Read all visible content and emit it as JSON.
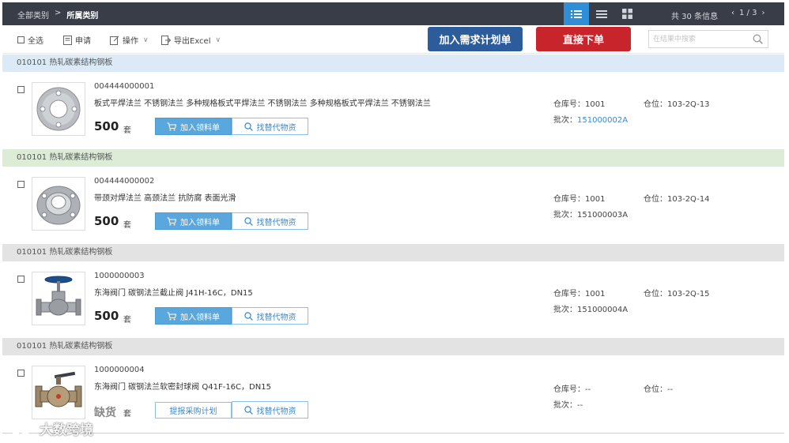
{
  "breadcrumb": {
    "root": "全部类别",
    "separator": ">",
    "current": "所属类别"
  },
  "view_modes": {
    "active": "detail-list",
    "icons": [
      "detail-list-icon",
      "list-icon",
      "grid-icon"
    ]
  },
  "summary": {
    "total": "共 30 条信息",
    "page": "1 / 3",
    "prev": "‹",
    "next": "›"
  },
  "toolbar": {
    "select_all": "全选",
    "apply": "申请",
    "operate": "操作",
    "export": "导出Excel",
    "add_plan": "加入需求计划单",
    "order_now": "直接下单",
    "search_placeholder": "在结果中搜索"
  },
  "labels": {
    "warehouse": "仓库号：",
    "location": "仓位：",
    "batch": "批次：",
    "add_to_list": "加入领料单",
    "find_substitute": "找替代物资",
    "purchase_plan": "提报采购计划"
  },
  "items": [
    {
      "group": "010101 热轧碳素结构钢板",
      "code": "004444000001",
      "description": "板式平焊法兰 不锈钢法兰 多种规格板式平焊法兰 不锈钢法兰 多种规格板式平焊法兰 不锈钢法兰",
      "quantity": "500",
      "unit": "套",
      "warehouse": "1001",
      "location": "103-2Q-13",
      "batch": "151000002A",
      "image": "flat-flange-icon"
    },
    {
      "group": "010101 热轧碳素结构钢板",
      "code": "004444000002",
      "description": "带颈对焊法兰 高颈法兰 抗防腐 表面光滑",
      "quantity": "500",
      "unit": "套",
      "warehouse": "1001",
      "location": "103-2Q-14",
      "batch": "151000003A",
      "image": "neck-flange-icon"
    },
    {
      "group": "010101 热轧碳素结构钢板",
      "code": "1000000003",
      "description": "东海阀门 碳钢法兰截止阀 J41H-16C，DN15",
      "quantity": "500",
      "unit": "套",
      "warehouse": "1001",
      "location": "103-2Q-15",
      "batch": "151000004A",
      "image": "globe-valve-icon"
    },
    {
      "group": "010101 热轧碳素结构钢板",
      "code": "1000000004",
      "description": "东海阀门 碳钢法兰软密封球阀 Q41F-16C，DN15",
      "quantity": "缺货",
      "unit": "套",
      "warehouse": "--",
      "location": "--",
      "batch": "--",
      "image": "ball-valve-icon"
    }
  ],
  "watermark": "大数跨境",
  "colors": {
    "topbar": "#383d48",
    "active_view": "#2f8ed6",
    "plan_button": "#2d5c9c",
    "order_button": "#c8242b",
    "accent_blue": "#5aa7dd",
    "link": "#3d8ac7"
  }
}
